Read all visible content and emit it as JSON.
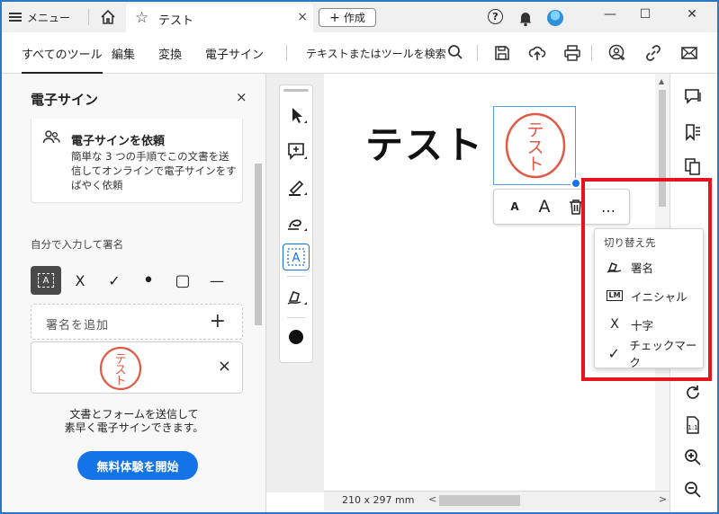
{
  "tabbar": {
    "menu_label": "メニュー",
    "tab_title": "テスト",
    "create_label": "作成",
    "create_plus": "+",
    "tab_close": "×",
    "help": "?",
    "minimize": "—",
    "maximize": "☐",
    "close": "✕"
  },
  "toolbar": {
    "tabs": [
      "すべてのツール",
      "編集",
      "変換",
      "電子サイン"
    ],
    "search_text": "テキストまたはツールを検索"
  },
  "leftpanel": {
    "title": "電子サイン",
    "close": "×",
    "request_title": "電子サインを依頼",
    "request_desc": "簡単な 3 つの手順でこの文書を送信してオンラインで電子サインをすばやく依頼",
    "self_label": "自分で入力して署名",
    "tools": {
      "text": "A",
      "cross": "X",
      "check": "✓",
      "dot": "•",
      "rect": "▢",
      "line": "—"
    },
    "add_signature": "署名を追加",
    "add_plus": "+",
    "saved_delete": "×",
    "promo_line1": "文書とフォームを送信して",
    "promo_line2": "素早く電子サインできます。",
    "trial_button": "無料体験を開始"
  },
  "document": {
    "text": "テスト",
    "stamp_text": "テスト",
    "stamp_color": "#e05a47",
    "page_size": "210 x 297 mm"
  },
  "format_bar": {
    "small_a": "A",
    "large_a": "A",
    "more": "…"
  },
  "dropdown": {
    "header": "切り替え先",
    "items": [
      {
        "label": "署名",
        "icon": "signature-pen-icon"
      },
      {
        "label": "イニシャル",
        "icon": "initials-icon",
        "glyph": "LM"
      },
      {
        "label": "十字",
        "icon": "cross-icon",
        "glyph": "X"
      },
      {
        "label": "チェックマーク",
        "icon": "checkmark-icon",
        "glyph": "✓"
      }
    ]
  },
  "colors": {
    "accent": "#1473e6",
    "highlight": "#e8141c",
    "window_border": "#2b78c6"
  }
}
